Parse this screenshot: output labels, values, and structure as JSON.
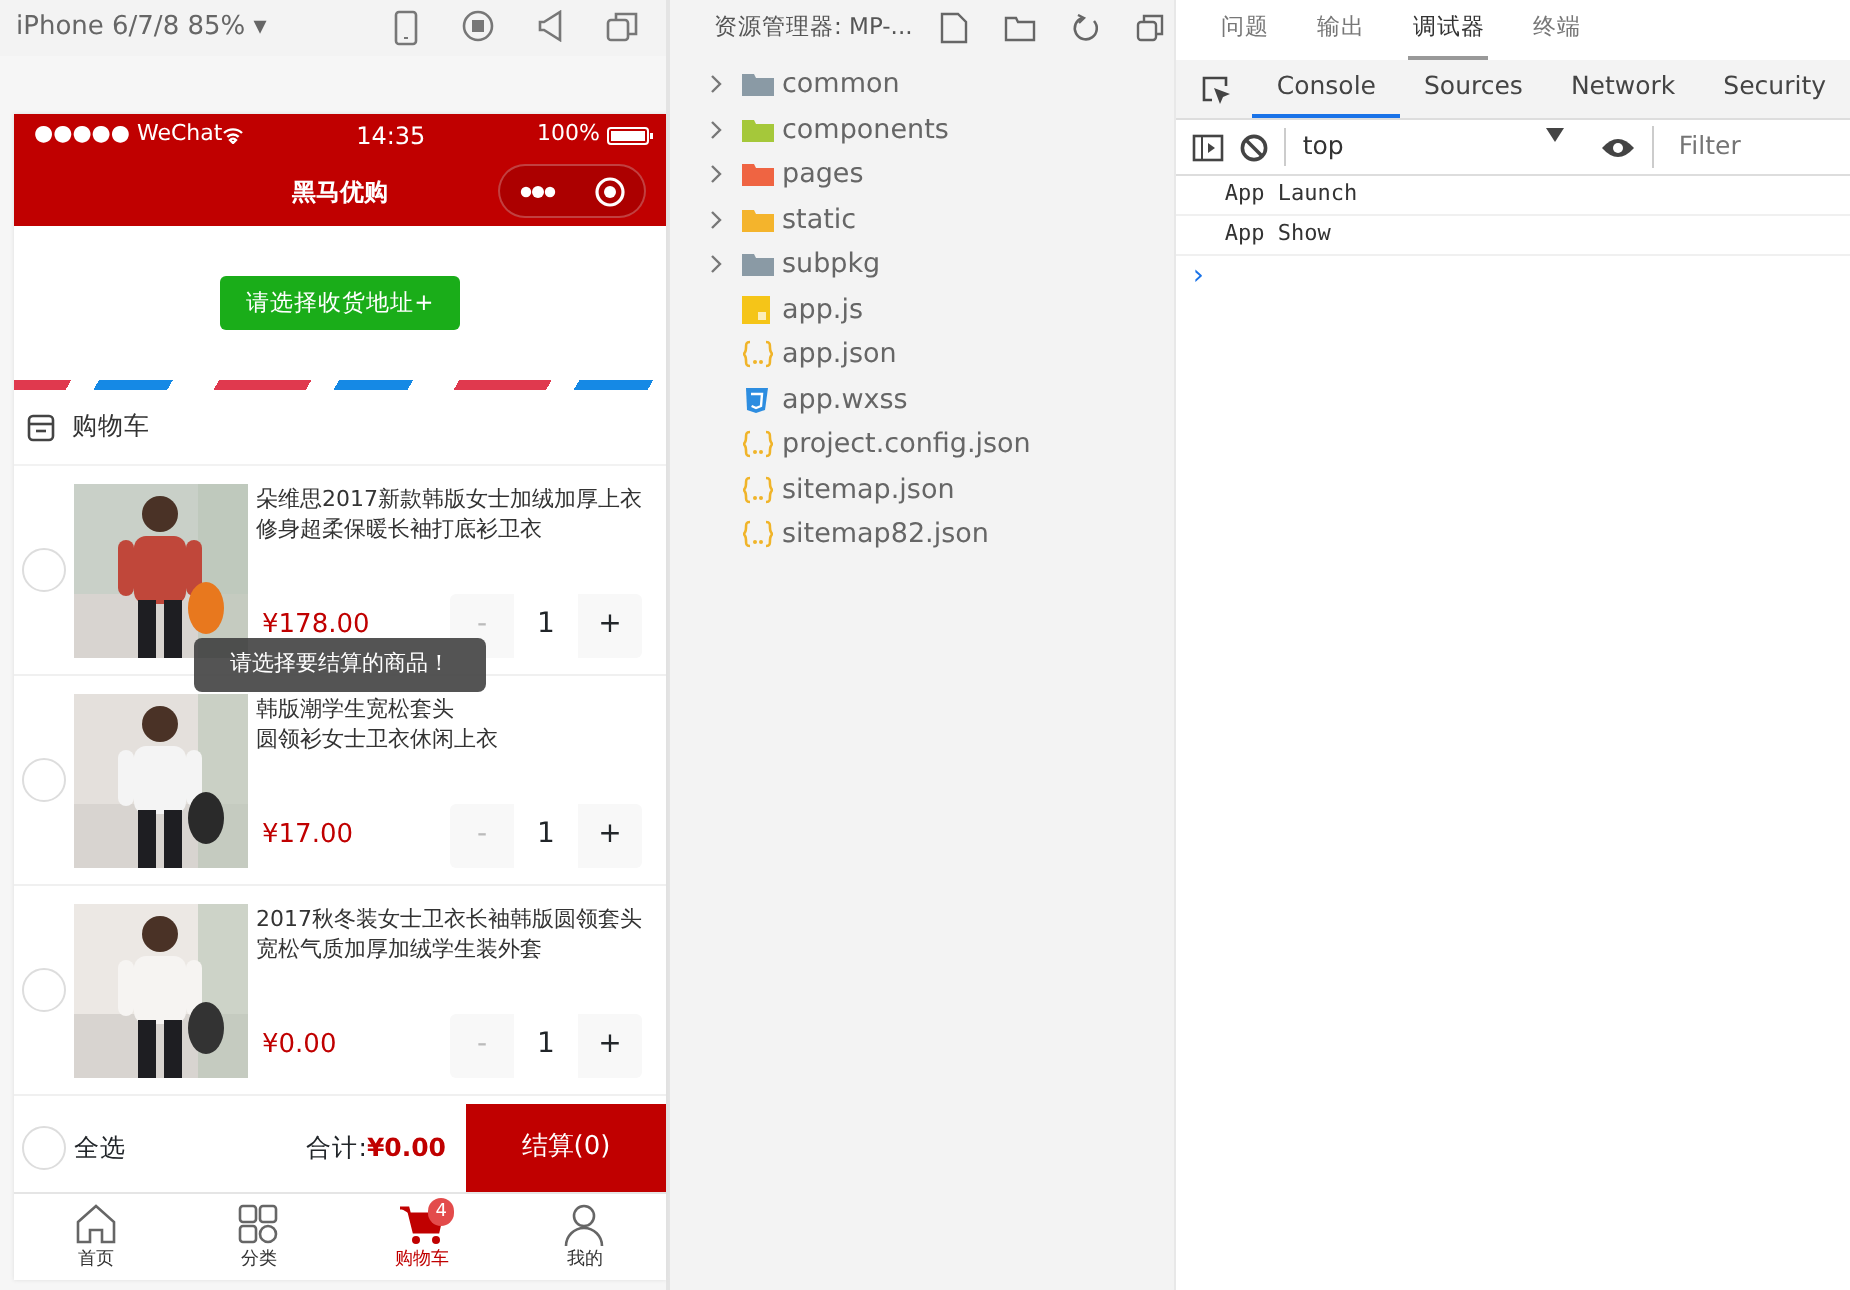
{
  "simulator": {
    "device": "iPhone 6/7/8 85%",
    "caret": "▾"
  },
  "phone": {
    "status": {
      "carrier": "●●●●● WeChat",
      "time": "14:35",
      "battery": "100%"
    },
    "nav_title": "黑马优购",
    "address_button": "请选择收货地址+",
    "cart_title": "购物车",
    "products": [
      {
        "title_lines": [
          "朵维思2017新款韩版女士加绒加厚上衣",
          "修身超柔保暖长袖打底衫卫衣"
        ],
        "price": "¥178.00",
        "minus": "-",
        "quantity": "1",
        "plus": "+",
        "checked": false
      },
      {
        "title_lines": [
          "韩版潮学生宽松套头",
          "圆领衫女士卫衣休闲上衣"
        ],
        "price": "¥17.00",
        "minus": "-",
        "quantity": "1",
        "plus": "+",
        "checked": false
      },
      {
        "title_lines": [
          "2017秋冬装女士卫衣长袖韩版圆领套头",
          "宽松气质加厚加绒学生装外套"
        ],
        "price": "¥0.00",
        "minus": "-",
        "quantity": "1",
        "plus": "+",
        "checked": false
      }
    ],
    "toast": "请选择要结算的商品！",
    "footer": {
      "select_all": "全选",
      "select_all_checked": false,
      "total_label": "合计:",
      "total": "¥0.00",
      "checkout": "结算(0)"
    },
    "tabbar": [
      {
        "label": "首页",
        "kind": "home",
        "selected": false
      },
      {
        "label": "分类",
        "kind": "grid",
        "selected": false
      },
      {
        "label": "购物车",
        "kind": "cart",
        "selected": true,
        "badge": "4"
      },
      {
        "label": "我的",
        "kind": "user",
        "selected": false
      }
    ]
  },
  "explorer": {
    "title": "资源管理器: MP-...",
    "items": [
      {
        "name": "common",
        "kind": "folder",
        "color": "#8a9aa5"
      },
      {
        "name": "components",
        "kind": "folder",
        "color": "#a5c83a"
      },
      {
        "name": "pages",
        "kind": "folder",
        "color": "#ef6442"
      },
      {
        "name": "static",
        "kind": "folder",
        "color": "#f4b42c"
      },
      {
        "name": "subpkg",
        "kind": "folder",
        "color": "#8a9aa5"
      },
      {
        "name": "app.js",
        "kind": "js"
      },
      {
        "name": "app.json",
        "kind": "json"
      },
      {
        "name": "app.wxss",
        "kind": "css"
      },
      {
        "name": "project.config.json",
        "kind": "json"
      },
      {
        "name": "sitemap.json",
        "kind": "json"
      },
      {
        "name": "sitemap82.json",
        "kind": "json"
      }
    ]
  },
  "devtools": {
    "panel_tabs": [
      {
        "label": "问题",
        "selected": false
      },
      {
        "label": "输出",
        "selected": false
      },
      {
        "label": "调试器",
        "selected": true
      },
      {
        "label": "终端",
        "selected": false
      }
    ],
    "tabs": [
      {
        "label": "Console",
        "selected": true
      },
      {
        "label": "Sources",
        "selected": false
      },
      {
        "label": "Network",
        "selected": false
      },
      {
        "label": "Security",
        "selected": false
      }
    ],
    "context": "top",
    "filter_placeholder": "Filter",
    "logs": [
      "App  Launch",
      "App  Show"
    ],
    "prompt": "›"
  }
}
